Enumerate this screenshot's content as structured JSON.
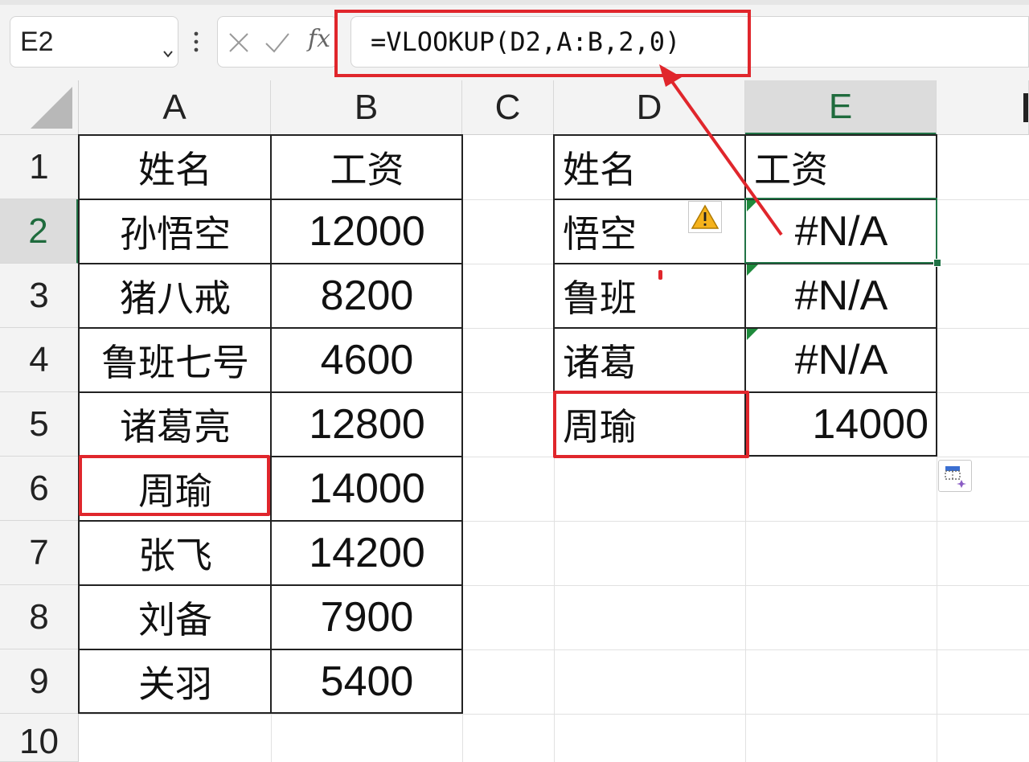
{
  "formula_bar": {
    "name_box": "E2",
    "fx_label": "fx",
    "formula": "=VLOOKUP(D2,A:B,2,0)"
  },
  "columns": [
    "A",
    "B",
    "C",
    "D",
    "E"
  ],
  "rows": [
    "1",
    "2",
    "3",
    "4",
    "5",
    "6",
    "7",
    "8",
    "9",
    "10"
  ],
  "source_table": {
    "headers": [
      "姓名",
      "工资"
    ],
    "rows": [
      [
        "孙悟空",
        "12000"
      ],
      [
        "猪八戒",
        "8200"
      ],
      [
        "鲁班七号",
        "4600"
      ],
      [
        "诸葛亮",
        "12800"
      ],
      [
        "周瑜",
        "14000"
      ],
      [
        "张飞",
        "14200"
      ],
      [
        "刘备",
        "7900"
      ],
      [
        "关羽",
        "5400"
      ]
    ]
  },
  "lookup_table": {
    "headers": [
      "姓名",
      "工资"
    ],
    "rows": [
      [
        "悟空",
        "#N/A"
      ],
      [
        "鲁班",
        "#N/A"
      ],
      [
        "诸葛",
        "#N/A"
      ],
      [
        "周瑜",
        "14000"
      ]
    ]
  },
  "colors": {
    "highlight": "#e0262c",
    "selection": "#217346",
    "error_indicator": "#1e8a3c"
  },
  "icons": {
    "warning": "warning-icon",
    "paste_options": "paste-options-icon",
    "cancel": "cancel-icon",
    "enter": "enter-icon"
  }
}
